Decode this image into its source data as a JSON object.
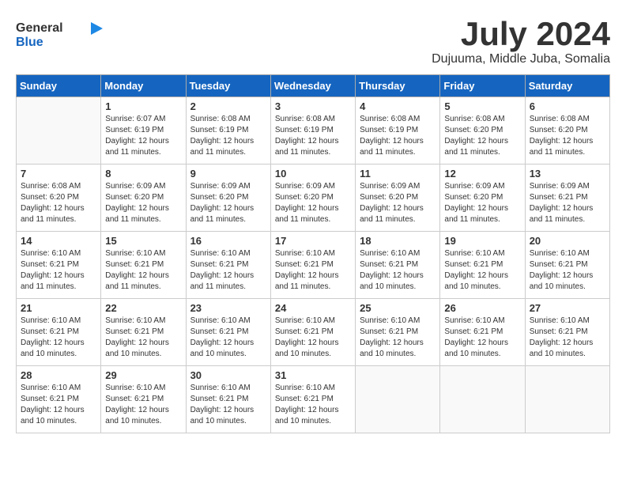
{
  "header": {
    "logo_general": "General",
    "logo_blue": "Blue",
    "month": "July 2024",
    "location": "Dujuuma, Middle Juba, Somalia"
  },
  "weekdays": [
    "Sunday",
    "Monday",
    "Tuesday",
    "Wednesday",
    "Thursday",
    "Friday",
    "Saturday"
  ],
  "weeks": [
    [
      {
        "day": "",
        "sunrise": "",
        "sunset": "",
        "daylight": ""
      },
      {
        "day": "1",
        "sunrise": "Sunrise: 6:07 AM",
        "sunset": "Sunset: 6:19 PM",
        "daylight": "Daylight: 12 hours and 11 minutes."
      },
      {
        "day": "2",
        "sunrise": "Sunrise: 6:08 AM",
        "sunset": "Sunset: 6:19 PM",
        "daylight": "Daylight: 12 hours and 11 minutes."
      },
      {
        "day": "3",
        "sunrise": "Sunrise: 6:08 AM",
        "sunset": "Sunset: 6:19 PM",
        "daylight": "Daylight: 12 hours and 11 minutes."
      },
      {
        "day": "4",
        "sunrise": "Sunrise: 6:08 AM",
        "sunset": "Sunset: 6:19 PM",
        "daylight": "Daylight: 12 hours and 11 minutes."
      },
      {
        "day": "5",
        "sunrise": "Sunrise: 6:08 AM",
        "sunset": "Sunset: 6:20 PM",
        "daylight": "Daylight: 12 hours and 11 minutes."
      },
      {
        "day": "6",
        "sunrise": "Sunrise: 6:08 AM",
        "sunset": "Sunset: 6:20 PM",
        "daylight": "Daylight: 12 hours and 11 minutes."
      }
    ],
    [
      {
        "day": "7",
        "sunrise": "Sunrise: 6:08 AM",
        "sunset": "Sunset: 6:20 PM",
        "daylight": "Daylight: 12 hours and 11 minutes."
      },
      {
        "day": "8",
        "sunrise": "Sunrise: 6:09 AM",
        "sunset": "Sunset: 6:20 PM",
        "daylight": "Daylight: 12 hours and 11 minutes."
      },
      {
        "day": "9",
        "sunrise": "Sunrise: 6:09 AM",
        "sunset": "Sunset: 6:20 PM",
        "daylight": "Daylight: 12 hours and 11 minutes."
      },
      {
        "day": "10",
        "sunrise": "Sunrise: 6:09 AM",
        "sunset": "Sunset: 6:20 PM",
        "daylight": "Daylight: 12 hours and 11 minutes."
      },
      {
        "day": "11",
        "sunrise": "Sunrise: 6:09 AM",
        "sunset": "Sunset: 6:20 PM",
        "daylight": "Daylight: 12 hours and 11 minutes."
      },
      {
        "day": "12",
        "sunrise": "Sunrise: 6:09 AM",
        "sunset": "Sunset: 6:20 PM",
        "daylight": "Daylight: 12 hours and 11 minutes."
      },
      {
        "day": "13",
        "sunrise": "Sunrise: 6:09 AM",
        "sunset": "Sunset: 6:21 PM",
        "daylight": "Daylight: 12 hours and 11 minutes."
      }
    ],
    [
      {
        "day": "14",
        "sunrise": "Sunrise: 6:10 AM",
        "sunset": "Sunset: 6:21 PM",
        "daylight": "Daylight: 12 hours and 11 minutes."
      },
      {
        "day": "15",
        "sunrise": "Sunrise: 6:10 AM",
        "sunset": "Sunset: 6:21 PM",
        "daylight": "Daylight: 12 hours and 11 minutes."
      },
      {
        "day": "16",
        "sunrise": "Sunrise: 6:10 AM",
        "sunset": "Sunset: 6:21 PM",
        "daylight": "Daylight: 12 hours and 11 minutes."
      },
      {
        "day": "17",
        "sunrise": "Sunrise: 6:10 AM",
        "sunset": "Sunset: 6:21 PM",
        "daylight": "Daylight: 12 hours and 11 minutes."
      },
      {
        "day": "18",
        "sunrise": "Sunrise: 6:10 AM",
        "sunset": "Sunset: 6:21 PM",
        "daylight": "Daylight: 12 hours and 10 minutes."
      },
      {
        "day": "19",
        "sunrise": "Sunrise: 6:10 AM",
        "sunset": "Sunset: 6:21 PM",
        "daylight": "Daylight: 12 hours and 10 minutes."
      },
      {
        "day": "20",
        "sunrise": "Sunrise: 6:10 AM",
        "sunset": "Sunset: 6:21 PM",
        "daylight": "Daylight: 12 hours and 10 minutes."
      }
    ],
    [
      {
        "day": "21",
        "sunrise": "Sunrise: 6:10 AM",
        "sunset": "Sunset: 6:21 PM",
        "daylight": "Daylight: 12 hours and 10 minutes."
      },
      {
        "day": "22",
        "sunrise": "Sunrise: 6:10 AM",
        "sunset": "Sunset: 6:21 PM",
        "daylight": "Daylight: 12 hours and 10 minutes."
      },
      {
        "day": "23",
        "sunrise": "Sunrise: 6:10 AM",
        "sunset": "Sunset: 6:21 PM",
        "daylight": "Daylight: 12 hours and 10 minutes."
      },
      {
        "day": "24",
        "sunrise": "Sunrise: 6:10 AM",
        "sunset": "Sunset: 6:21 PM",
        "daylight": "Daylight: 12 hours and 10 minutes."
      },
      {
        "day": "25",
        "sunrise": "Sunrise: 6:10 AM",
        "sunset": "Sunset: 6:21 PM",
        "daylight": "Daylight: 12 hours and 10 minutes."
      },
      {
        "day": "26",
        "sunrise": "Sunrise: 6:10 AM",
        "sunset": "Sunset: 6:21 PM",
        "daylight": "Daylight: 12 hours and 10 minutes."
      },
      {
        "day": "27",
        "sunrise": "Sunrise: 6:10 AM",
        "sunset": "Sunset: 6:21 PM",
        "daylight": "Daylight: 12 hours and 10 minutes."
      }
    ],
    [
      {
        "day": "28",
        "sunrise": "Sunrise: 6:10 AM",
        "sunset": "Sunset: 6:21 PM",
        "daylight": "Daylight: 12 hours and 10 minutes."
      },
      {
        "day": "29",
        "sunrise": "Sunrise: 6:10 AM",
        "sunset": "Sunset: 6:21 PM",
        "daylight": "Daylight: 12 hours and 10 minutes."
      },
      {
        "day": "30",
        "sunrise": "Sunrise: 6:10 AM",
        "sunset": "Sunset: 6:21 PM",
        "daylight": "Daylight: 12 hours and 10 minutes."
      },
      {
        "day": "31",
        "sunrise": "Sunrise: 6:10 AM",
        "sunset": "Sunset: 6:21 PM",
        "daylight": "Daylight: 12 hours and 10 minutes."
      },
      {
        "day": "",
        "sunrise": "",
        "sunset": "",
        "daylight": ""
      },
      {
        "day": "",
        "sunrise": "",
        "sunset": "",
        "daylight": ""
      },
      {
        "day": "",
        "sunrise": "",
        "sunset": "",
        "daylight": ""
      }
    ]
  ]
}
